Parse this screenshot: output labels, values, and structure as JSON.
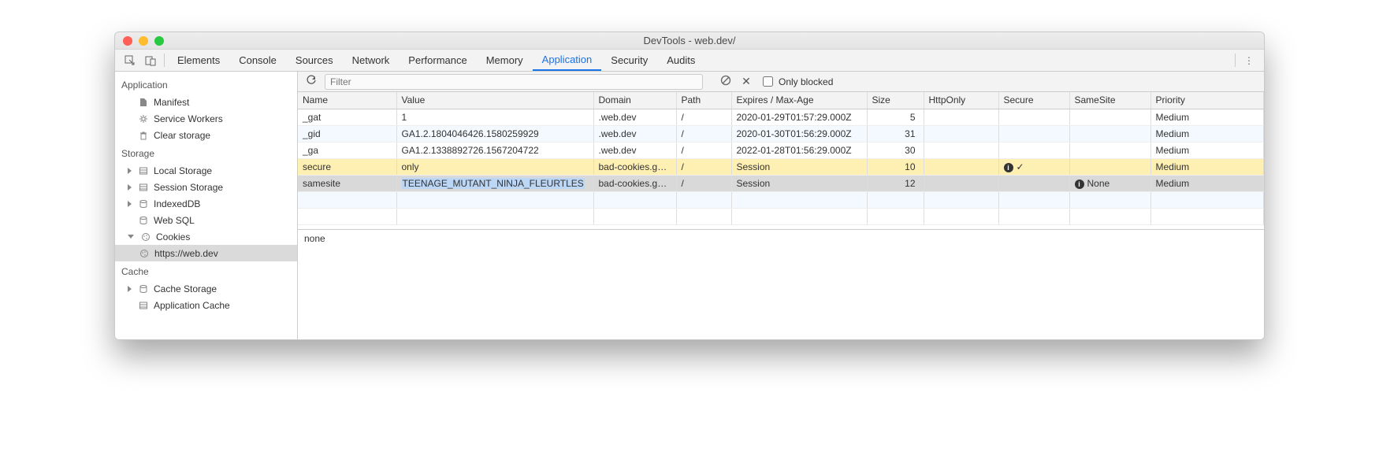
{
  "window": {
    "title": "DevTools - web.dev/"
  },
  "tabs": {
    "items": [
      {
        "label": "Elements"
      },
      {
        "label": "Console"
      },
      {
        "label": "Sources"
      },
      {
        "label": "Network"
      },
      {
        "label": "Performance"
      },
      {
        "label": "Memory"
      },
      {
        "label": "Application"
      },
      {
        "label": "Security"
      },
      {
        "label": "Audits"
      }
    ],
    "active_index": 6
  },
  "sidebar": {
    "sections": [
      {
        "title": "Application",
        "items": [
          {
            "label": "Manifest",
            "icon": "file"
          },
          {
            "label": "Service Workers",
            "icon": "gear"
          },
          {
            "label": "Clear storage",
            "icon": "trash"
          }
        ]
      },
      {
        "title": "Storage",
        "items": [
          {
            "label": "Local Storage",
            "icon": "db-grid",
            "expandable": true
          },
          {
            "label": "Session Storage",
            "icon": "db-grid",
            "expandable": true
          },
          {
            "label": "IndexedDB",
            "icon": "db",
            "expandable": true
          },
          {
            "label": "Web SQL",
            "icon": "db"
          },
          {
            "label": "Cookies",
            "icon": "cookie",
            "expandable": true,
            "expanded": true,
            "children": [
              {
                "label": "https://web.dev",
                "icon": "cookie",
                "selected": true
              }
            ]
          }
        ]
      },
      {
        "title": "Cache",
        "items": [
          {
            "label": "Cache Storage",
            "icon": "db",
            "expandable": true
          },
          {
            "label": "Application Cache",
            "icon": "db-grid"
          }
        ]
      }
    ]
  },
  "toolbar": {
    "filter_placeholder": "Filter",
    "only_blocked_label": "Only blocked",
    "only_blocked_checked": false
  },
  "cookies": {
    "columns": [
      "Name",
      "Value",
      "Domain",
      "Path",
      "Expires / Max-Age",
      "Size",
      "HttpOnly",
      "Secure",
      "SameSite",
      "Priority"
    ],
    "rows": [
      {
        "name": "_gat",
        "value": "1",
        "domain": ".web.dev",
        "path": "/",
        "expires": "2020-01-29T01:57:29.000Z",
        "size": "5",
        "httponly": "",
        "secure": "",
        "samesite": "",
        "priority": "Medium",
        "state": "normal"
      },
      {
        "name": "_gid",
        "value": "GA1.2.1804046426.1580259929",
        "domain": ".web.dev",
        "path": "/",
        "expires": "2020-01-30T01:56:29.000Z",
        "size": "31",
        "httponly": "",
        "secure": "",
        "samesite": "",
        "priority": "Medium",
        "state": "normal"
      },
      {
        "name": "_ga",
        "value": "GA1.2.1338892726.1567204722",
        "domain": ".web.dev",
        "path": "/",
        "expires": "2022-01-28T01:56:29.000Z",
        "size": "30",
        "httponly": "",
        "secure": "",
        "samesite": "",
        "priority": "Medium",
        "state": "normal"
      },
      {
        "name": "secure",
        "value": "only",
        "domain": "bad-cookies.g…",
        "path": "/",
        "expires": "Session",
        "size": "10",
        "httponly": "",
        "secure": "ⓘ ✓",
        "secure_info": true,
        "samesite": "",
        "priority": "Medium",
        "state": "highlight"
      },
      {
        "name": "samesite",
        "value": "TEENAGE_MUTANT_NINJA_FLEURTLES",
        "domain": "bad-cookies.g…",
        "path": "/",
        "expires": "Session",
        "size": "12",
        "httponly": "",
        "secure": "",
        "samesite": "ⓘ None",
        "samesite_info": true,
        "samesite_text": "None",
        "priority": "Medium",
        "state": "selected",
        "value_selected": true
      }
    ],
    "empty_rows": 2
  },
  "detail": {
    "text": "none"
  }
}
